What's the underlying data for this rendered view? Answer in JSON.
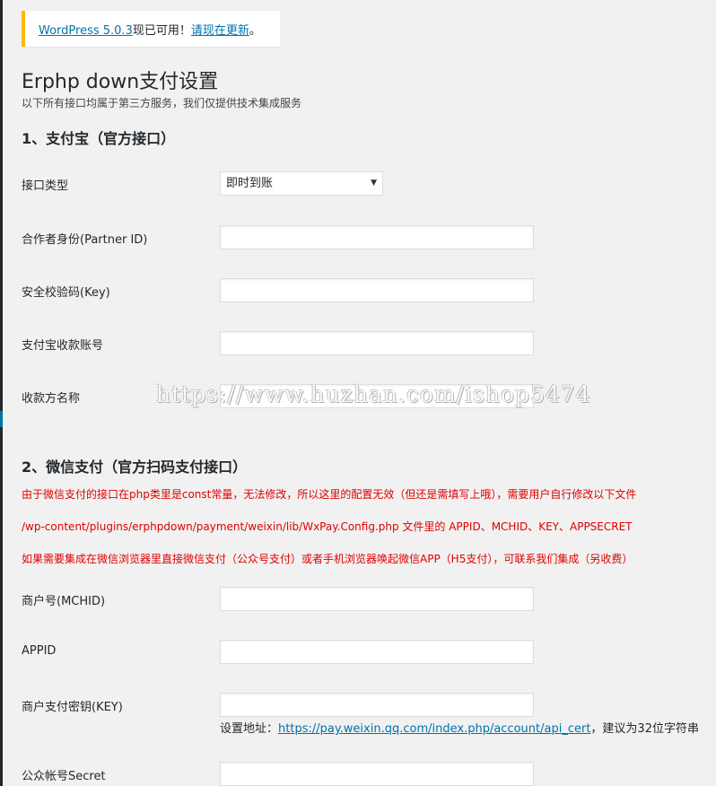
{
  "notice": {
    "version_link": "WordPress 5.0.3",
    "available_text": "现已可用！",
    "update_link": "请现在更新",
    "end": "。"
  },
  "page": {
    "title": "Erphp down支付设置",
    "subtitle": "以下所有接口均属于第三方服务，我们仅提供技术集成服务"
  },
  "alipay": {
    "heading": "1、支付宝（官方接口）",
    "type_label": "接口类型",
    "type_value": "即时到账",
    "partner_label": "合作者身份(Partner ID)",
    "key_label": "安全校验码(Key)",
    "account_label": "支付宝收款账号",
    "payee_label": "收款方名称"
  },
  "watermark": "https://www.huzhan.com/ishop5474",
  "wechat": {
    "heading": "2、微信支付（官方扫码支付接口）",
    "note1": "由于微信支付的接口在php类里是const常量，无法修改，所以这里的配置无效（但还是需填写上哦），需要用户自行修改以下文件",
    "note2": "/wp-content/plugins/erphpdown/payment/weixin/lib/WxPay.Config.php 文件里的 APPID、MCHID、KEY、APPSECRET",
    "note3": "如果需要集成在微信浏览器里直接微信支付（公众号支付）或者手机浏览器唤起微信APP（H5支付），可联系我们集成（另收费）",
    "mchid_label": "商户号(MCHID)",
    "appid_label": "APPID",
    "key_label": "商户支付密钥(KEY)",
    "hint_prefix": "设置地址：",
    "hint_link": "https://pay.weixin.qq.com/index.php/account/api_cert",
    "hint_suffix": "，建议为32位字符串",
    "secret_label": "公众帐号Secret"
  }
}
